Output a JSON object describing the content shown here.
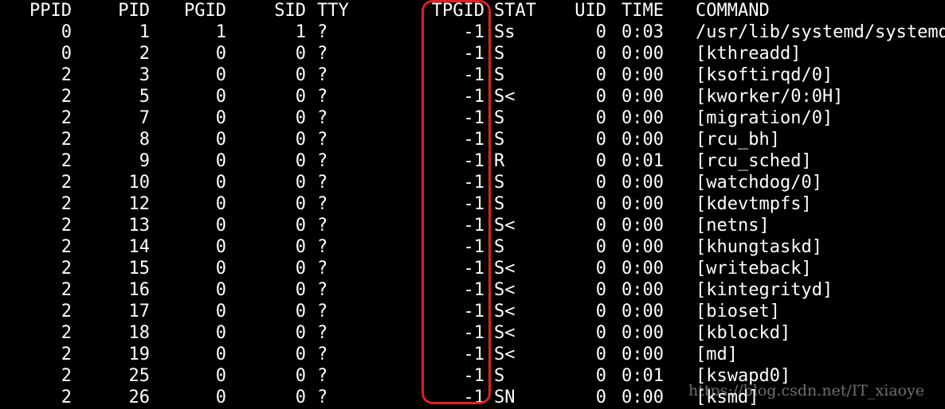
{
  "headers": {
    "ppid": "PPID",
    "pid": "PID",
    "pgid": "PGID",
    "sid": "SID",
    "tty": "TTY",
    "tpgid": "TPGID",
    "stat": "STAT",
    "uid": "UID",
    "time": "TIME",
    "command": "COMMAND"
  },
  "rows": [
    {
      "ppid": "0",
      "pid": "1",
      "pgid": "1",
      "sid": "1",
      "tty": "?",
      "tpgid": "-1",
      "stat": "Ss",
      "uid": "0",
      "time": "0:03",
      "command": "/usr/lib/systemd/systemd"
    },
    {
      "ppid": "0",
      "pid": "2",
      "pgid": "0",
      "sid": "0",
      "tty": "?",
      "tpgid": "-1",
      "stat": "S",
      "uid": "0",
      "time": "0:00",
      "command": "[kthreadd]"
    },
    {
      "ppid": "2",
      "pid": "3",
      "pgid": "0",
      "sid": "0",
      "tty": "?",
      "tpgid": "-1",
      "stat": "S",
      "uid": "0",
      "time": "0:00",
      "command": "[ksoftirqd/0]"
    },
    {
      "ppid": "2",
      "pid": "5",
      "pgid": "0",
      "sid": "0",
      "tty": "?",
      "tpgid": "-1",
      "stat": "S<",
      "uid": "0",
      "time": "0:00",
      "command": "[kworker/0:0H]"
    },
    {
      "ppid": "2",
      "pid": "7",
      "pgid": "0",
      "sid": "0",
      "tty": "?",
      "tpgid": "-1",
      "stat": "S",
      "uid": "0",
      "time": "0:00",
      "command": "[migration/0]"
    },
    {
      "ppid": "2",
      "pid": "8",
      "pgid": "0",
      "sid": "0",
      "tty": "?",
      "tpgid": "-1",
      "stat": "S",
      "uid": "0",
      "time": "0:00",
      "command": "[rcu_bh]"
    },
    {
      "ppid": "2",
      "pid": "9",
      "pgid": "0",
      "sid": "0",
      "tty": "?",
      "tpgid": "-1",
      "stat": "R",
      "uid": "0",
      "time": "0:01",
      "command": "[rcu_sched]"
    },
    {
      "ppid": "2",
      "pid": "10",
      "pgid": "0",
      "sid": "0",
      "tty": "?",
      "tpgid": "-1",
      "stat": "S",
      "uid": "0",
      "time": "0:00",
      "command": "[watchdog/0]"
    },
    {
      "ppid": "2",
      "pid": "12",
      "pgid": "0",
      "sid": "0",
      "tty": "?",
      "tpgid": "-1",
      "stat": "S",
      "uid": "0",
      "time": "0:00",
      "command": "[kdevtmpfs]"
    },
    {
      "ppid": "2",
      "pid": "13",
      "pgid": "0",
      "sid": "0",
      "tty": "?",
      "tpgid": "-1",
      "stat": "S<",
      "uid": "0",
      "time": "0:00",
      "command": "[netns]"
    },
    {
      "ppid": "2",
      "pid": "14",
      "pgid": "0",
      "sid": "0",
      "tty": "?",
      "tpgid": "-1",
      "stat": "S",
      "uid": "0",
      "time": "0:00",
      "command": "[khungtaskd]"
    },
    {
      "ppid": "2",
      "pid": "15",
      "pgid": "0",
      "sid": "0",
      "tty": "?",
      "tpgid": "-1",
      "stat": "S<",
      "uid": "0",
      "time": "0:00",
      "command": "[writeback]"
    },
    {
      "ppid": "2",
      "pid": "16",
      "pgid": "0",
      "sid": "0",
      "tty": "?",
      "tpgid": "-1",
      "stat": "S<",
      "uid": "0",
      "time": "0:00",
      "command": "[kintegrityd]"
    },
    {
      "ppid": "2",
      "pid": "17",
      "pgid": "0",
      "sid": "0",
      "tty": "?",
      "tpgid": "-1",
      "stat": "S<",
      "uid": "0",
      "time": "0:00",
      "command": "[bioset]"
    },
    {
      "ppid": "2",
      "pid": "18",
      "pgid": "0",
      "sid": "0",
      "tty": "?",
      "tpgid": "-1",
      "stat": "S<",
      "uid": "0",
      "time": "0:00",
      "command": "[kblockd]"
    },
    {
      "ppid": "2",
      "pid": "19",
      "pgid": "0",
      "sid": "0",
      "tty": "?",
      "tpgid": "-1",
      "stat": "S<",
      "uid": "0",
      "time": "0:00",
      "command": "[md]"
    },
    {
      "ppid": "2",
      "pid": "25",
      "pgid": "0",
      "sid": "0",
      "tty": "?",
      "tpgid": "-1",
      "stat": "S",
      "uid": "0",
      "time": "0:01",
      "command": "[kswapd0]"
    },
    {
      "ppid": "2",
      "pid": "26",
      "pgid": "0",
      "sid": "0",
      "tty": "?",
      "tpgid": "-1",
      "stat": "SN",
      "uid": "0",
      "time": "0:00",
      "command": "[ksmd]"
    }
  ],
  "watermark": "https://blog.csdn.net/IT_xiaoye",
  "colors": {
    "background": "#000000",
    "text": "#ffffff",
    "highlight": "#e02020"
  }
}
